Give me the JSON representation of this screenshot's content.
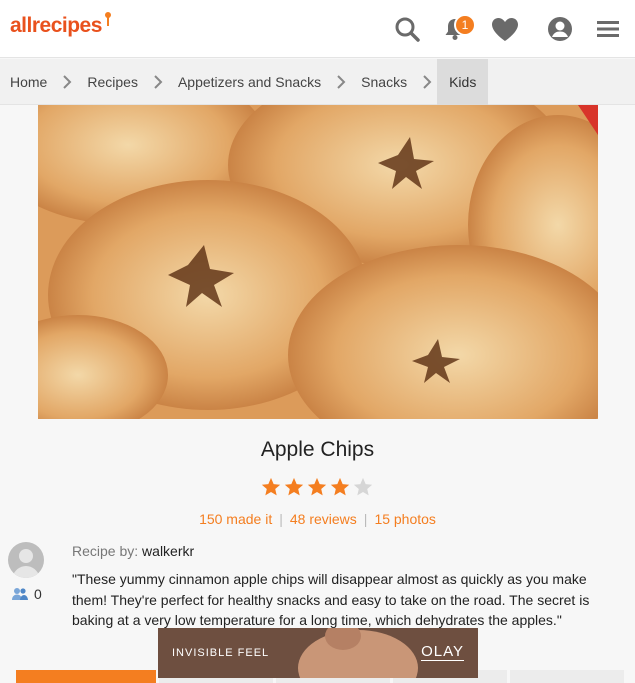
{
  "header": {
    "logo_text": "allrecipes",
    "notification_count": "1",
    "icons": [
      "search-icon",
      "bell-icon",
      "heart-icon",
      "user-icon",
      "menu-icon"
    ],
    "accent_color": "#f47e20"
  },
  "breadcrumb": {
    "items": [
      "Home",
      "Recipes",
      "Appetizers and Snacks",
      "Snacks",
      "Kids"
    ]
  },
  "recipe": {
    "title": "Apple Chips",
    "rating": 4,
    "rating_max": 5,
    "made_it": "150 made it",
    "reviews": "48 reviews",
    "photos": "15 photos",
    "by_label": "Recipe by:",
    "author": "walkerkr",
    "followers": "0",
    "description": "\"These yummy cinnamon apple chips will disappear almost as quickly as you make them! They're perfect for healthy snacks and easy to take on the road. The secret is baking at a very low temperature for a long time, which dehydrates the apples.\""
  },
  "ad": {
    "text": "INVISIBLE FEEL",
    "brand": "OLAY"
  }
}
